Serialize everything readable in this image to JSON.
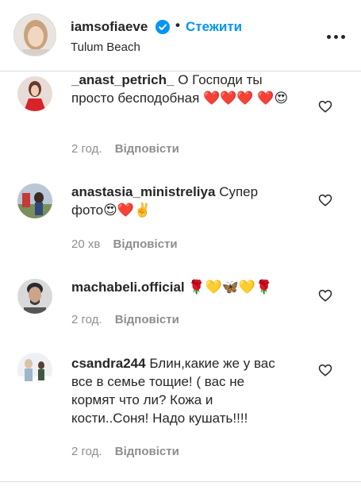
{
  "post": {
    "username": "iamsofiaeve",
    "separator": "•",
    "follow_label": "Стежити",
    "location": "Tulum Beach",
    "verified_color": "#0095f6",
    "accent_color": "#0095f6"
  },
  "comments": [
    {
      "username": "_anast_petrich_",
      "text": "О Господи ты просто бесподобная ❤️❤️❤️ ❤️😍",
      "time": "2 год.",
      "reply_label": "Відповісти",
      "avatar": "avatar-woman-red-dress"
    },
    {
      "username": "anastasia_ministreliya",
      "text": "Супер фото😍❤️✌️",
      "time": "20 хв",
      "reply_label": "Відповісти",
      "avatar": "avatar-woman-outdoors"
    },
    {
      "username": "machabeli.official",
      "text": "🌹💛🦋💛🌹",
      "time": "2 год.",
      "reply_label": "Відповісти",
      "avatar": "avatar-man-portrait"
    },
    {
      "username": "csandra244",
      "text": "Блин,какие же у вас все в семье тощие! ( вас не кормят что ли? Кожа и кости..Соня! Надо кушать!!!!",
      "time": "2 год.",
      "reply_label": "Відповісти",
      "avatar": "avatar-outdoor-snow"
    }
  ]
}
